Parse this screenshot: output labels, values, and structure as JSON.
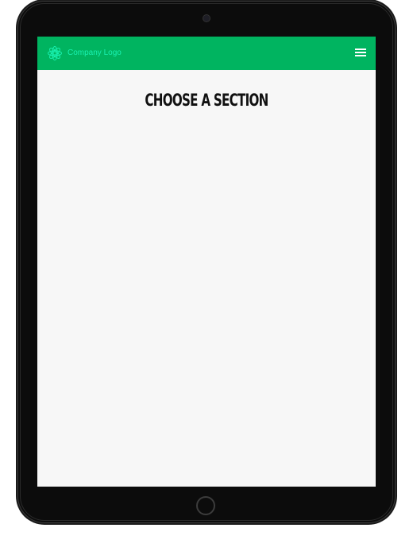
{
  "header": {
    "logo_text": "Company Logo",
    "background_color": "#00b460",
    "logo_color": "#19f1b0",
    "menu_icon": "hamburger-menu-icon"
  },
  "main": {
    "title": "CHOOSE A SECTION"
  }
}
